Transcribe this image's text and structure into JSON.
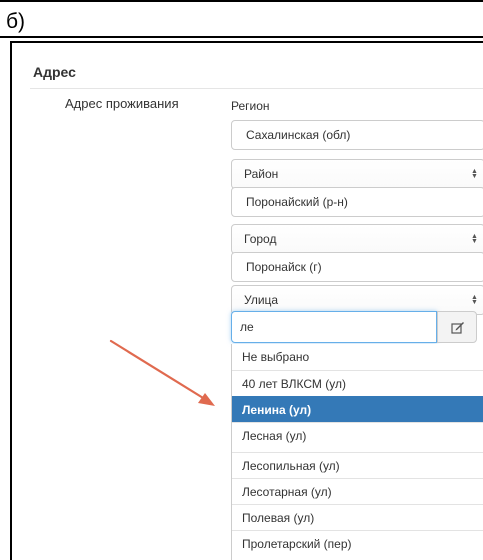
{
  "caption": "б)",
  "section": {
    "title": "Адрес"
  },
  "address": {
    "label": "Адрес проживания",
    "region_label": "Регион",
    "region_value": "Сахалинская (обл)",
    "district_select": "Район",
    "district_value": "Поронайский (р-н)",
    "city_select": "Город",
    "city_value": "Поронайск (г)",
    "street_select": "Улица",
    "street_search_value": "ле"
  },
  "icons": {
    "edit": "edit-icon",
    "select_caret": "updown-caret-icon",
    "pointer": "red-arrow"
  },
  "colors": {
    "highlight": "#3479b7",
    "arrow": "#e06a4f",
    "focus": "#66afe9"
  },
  "dropdown": {
    "items": [
      "Не выбрано",
      "40 лет ВЛКСМ (ул)",
      "Ленина (ул)",
      "Лесная (ул)",
      "Лесопильная (ул)",
      "Лесотарная (ул)",
      "Полевая (ул)",
      "Пролетарский (пер)"
    ],
    "active": "Ленина (ул)"
  }
}
